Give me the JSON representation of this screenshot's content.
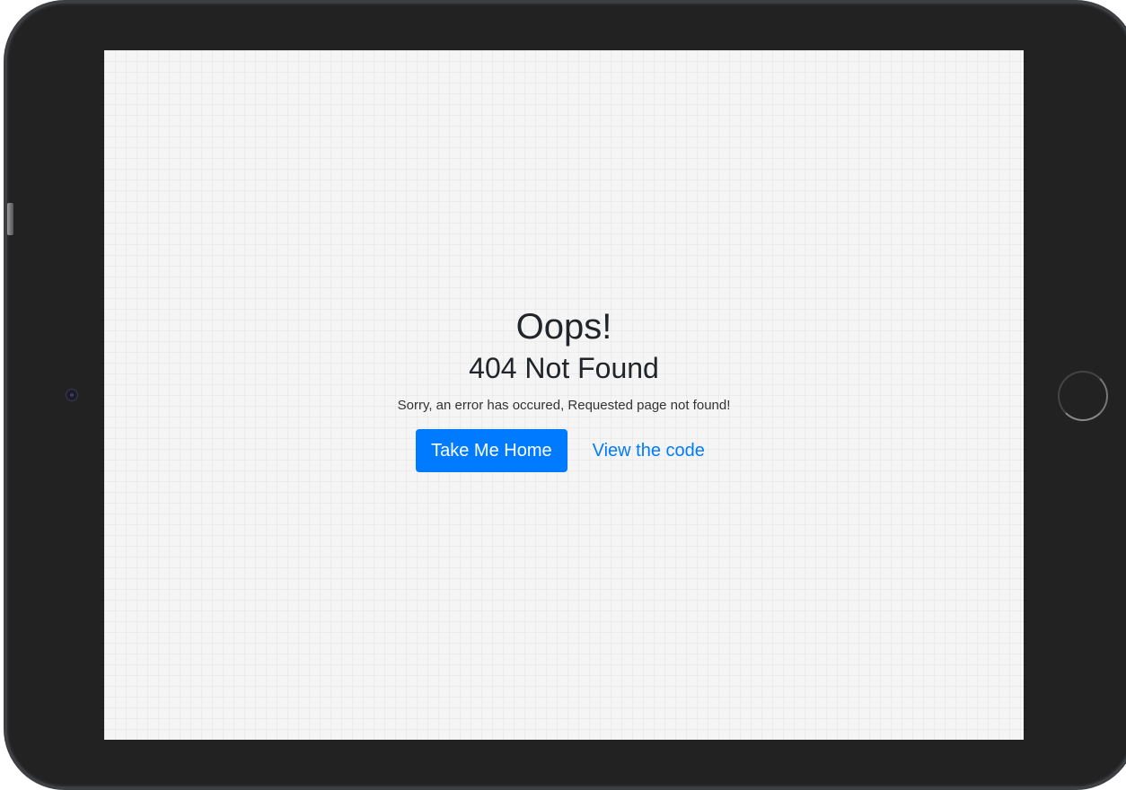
{
  "error_page": {
    "title": "Oops!",
    "subtitle": "404 Not Found",
    "message": "Sorry, an error has occured, Requested page not found!",
    "primary_button_label": "Take Me Home",
    "secondary_link_label": "View the code"
  },
  "colors": {
    "accent": "#007bff",
    "text": "#212529",
    "screen_background": "#f5f5f5",
    "device_frame": "#222222"
  },
  "icons": {
    "camera": "camera-icon",
    "home_button": "home-button-icon"
  }
}
